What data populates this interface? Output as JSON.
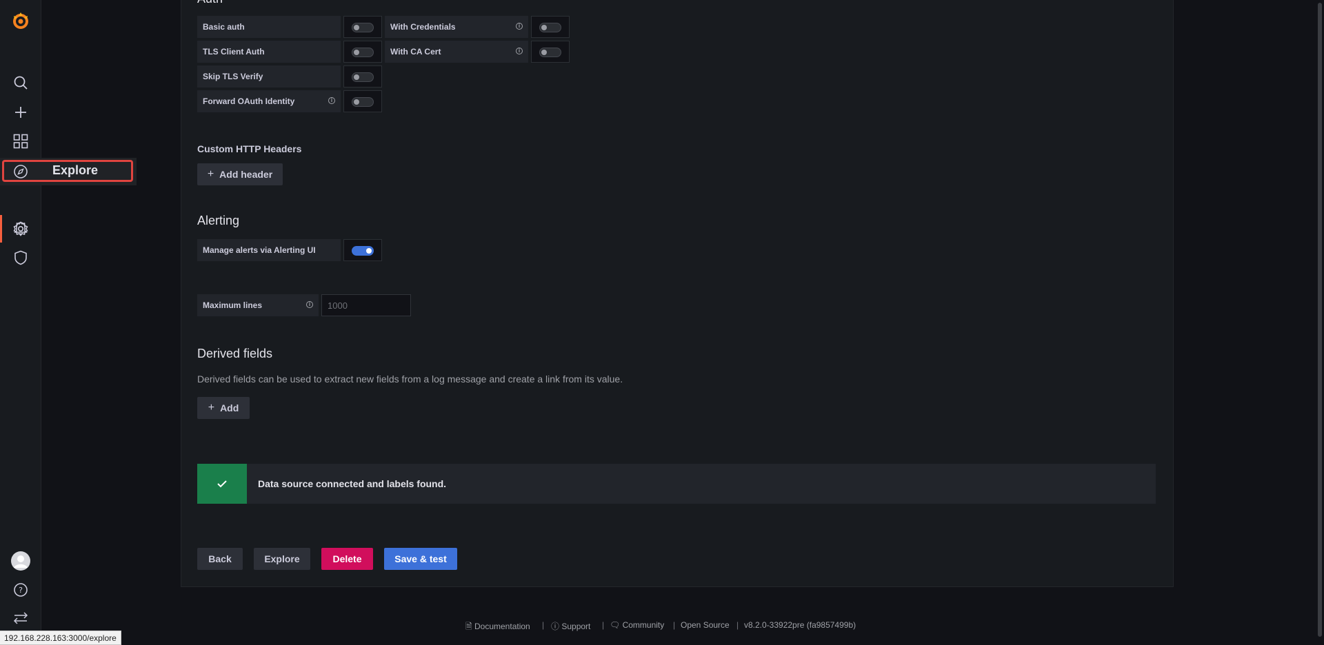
{
  "sidebar": {
    "explore_label": "Explore",
    "items": [
      {
        "name": "search-icon"
      },
      {
        "name": "plus-icon"
      },
      {
        "name": "dashboards-icon"
      },
      {
        "name": "explore-icon"
      },
      {
        "name": "bell-icon"
      },
      {
        "name": "gear-icon"
      },
      {
        "name": "shield-icon"
      }
    ]
  },
  "auth": {
    "title_partial": "Auth",
    "basic_auth": "Basic auth",
    "with_credentials": "With Credentials",
    "tls_client_auth": "TLS Client Auth",
    "with_ca_cert": "With CA Cert",
    "skip_tls_verify": "Skip TLS Verify",
    "forward_oauth": "Forward OAuth Identity"
  },
  "headers": {
    "title": "Custom HTTP Headers",
    "add_button": "Add header"
  },
  "alerting": {
    "title": "Alerting",
    "manage_alerts": "Manage alerts via Alerting UI",
    "manage_alerts_on": true
  },
  "max_lines": {
    "label": "Maximum lines",
    "placeholder": "1000"
  },
  "derived": {
    "title": "Derived fields",
    "description": "Derived fields can be used to extract new fields from a log message and create a link from its value.",
    "add_button": "Add"
  },
  "alert": {
    "message": "Data source connected and labels found."
  },
  "actions": {
    "back": "Back",
    "explore": "Explore",
    "delete": "Delete",
    "save_test": "Save & test"
  },
  "footer": {
    "documentation": "Documentation",
    "support": "Support",
    "community": "Community",
    "open_source": "Open Source",
    "version": "v8.2.0-33922pre (fa9857499b)"
  },
  "status_url": "192.168.228.163:3000/explore",
  "colors": {
    "accent_orange": "#f55f3e",
    "primary_blue": "#3d71d9",
    "delete_red": "#d10e5c",
    "success_green": "#1a7f4b"
  }
}
